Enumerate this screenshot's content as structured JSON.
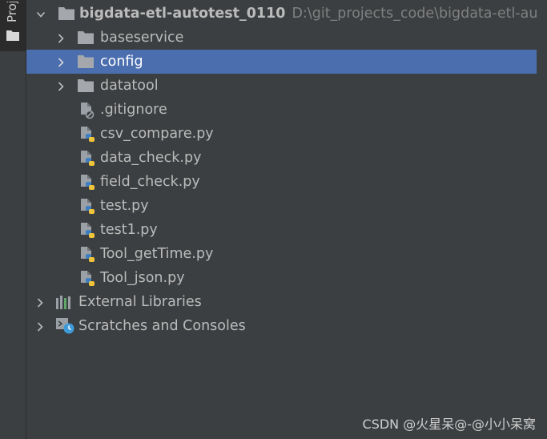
{
  "side_panel": {
    "tab_label": "Proj"
  },
  "tree": {
    "root": {
      "name": "bigdata-etl-autotest_0110",
      "path": "D:\\git_projects_code\\bigdata-etl-autot"
    },
    "items": [
      {
        "label": "baseservice",
        "kind": "folder"
      },
      {
        "label": "config",
        "kind": "folder",
        "selected": true
      },
      {
        "label": "datatool",
        "kind": "folder"
      },
      {
        "label": ".gitignore",
        "kind": "ignore-file"
      },
      {
        "label": "csv_compare.py",
        "kind": "python-file"
      },
      {
        "label": "data_check.py",
        "kind": "python-file"
      },
      {
        "label": "field_check.py",
        "kind": "python-file"
      },
      {
        "label": "test.py",
        "kind": "python-file"
      },
      {
        "label": "test1.py",
        "kind": "python-file"
      },
      {
        "label": "Tool_getTime.py",
        "kind": "python-file"
      },
      {
        "label": "Tool_json.py",
        "kind": "python-file"
      }
    ],
    "external_libraries": "External Libraries",
    "scratches": "Scratches and Consoles"
  },
  "watermark": "CSDN @火星呆@-@小小呆窝",
  "colors": {
    "background": "#3c3f41",
    "selection": "#4b6eaf",
    "text": "#bbbbbb",
    "path_text": "#808080",
    "folder": "#a4a8ad",
    "python_blue": "#3f7fc1",
    "python_yellow": "#f0c53a"
  }
}
